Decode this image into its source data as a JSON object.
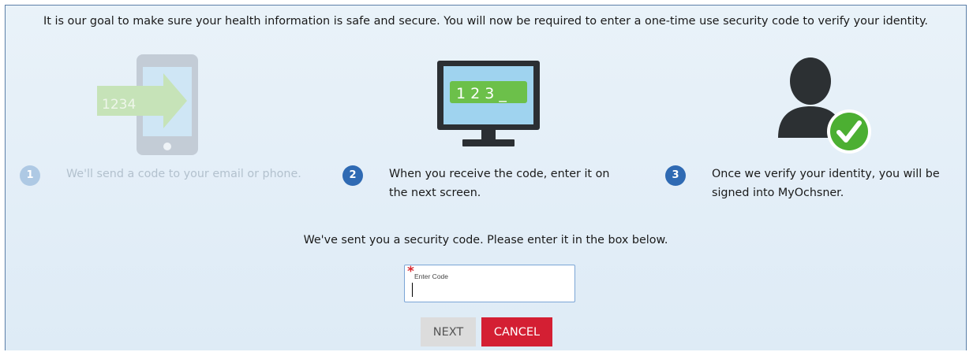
{
  "intro_text": "It is our goal to make sure your health information is safe and secure. You will now be required to enter a one-time use security code to verify your identity.",
  "steps": [
    {
      "number": "1",
      "text": "We'll send a code to your email or phone.",
      "illustration_code": "1234",
      "icon": "phone-send-code-icon",
      "state": "faded"
    },
    {
      "number": "2",
      "text": "When you receive the code, enter it on the next screen.",
      "illustration_code": "1 2 3 _",
      "icon": "monitor-code-icon",
      "state": "active"
    },
    {
      "number": "3",
      "text": "Once we verify your identity, you will be signed into MyOchsner.",
      "icon": "user-verified-icon",
      "state": "active"
    }
  ],
  "sent_message": "We've sent you a security code. Please enter it in the box below.",
  "code_field": {
    "label": "Enter Code",
    "required_mark": "*",
    "value": ""
  },
  "buttons": {
    "next": "NEXT",
    "cancel": "CANCEL"
  },
  "colors": {
    "active_step": "#2f6ab3",
    "faded_step": "#aec9e4",
    "cancel": "#d41f33",
    "check": "#4caf32",
    "monitor_code_bg": "#6cc04a"
  }
}
